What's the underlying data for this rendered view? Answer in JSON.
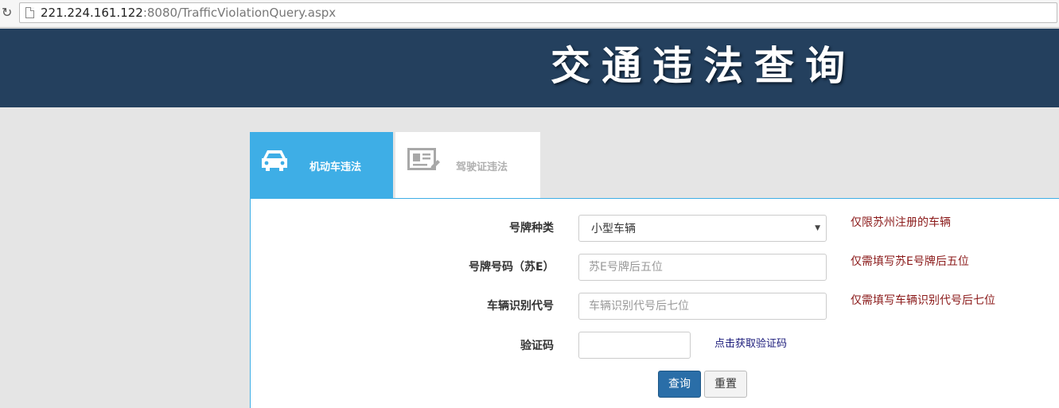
{
  "browser": {
    "url_host": "221.224.161.122",
    "url_rest": ":8080/TrafficViolationQuery.aspx"
  },
  "header": {
    "title": "交通违法查询"
  },
  "tabs": [
    {
      "label": "机动车违法",
      "icon": "car-icon",
      "active": true
    },
    {
      "label": "驾驶证违法",
      "icon": "id-card-icon",
      "active": false
    }
  ],
  "form": {
    "plate_type": {
      "label": "号牌种类",
      "value": "小型车辆",
      "hint": "仅限苏州注册的车辆"
    },
    "plate_number": {
      "label": "号牌号码（苏E）",
      "placeholder": "苏E号牌后五位",
      "hint": "仅需填写苏E号牌后五位"
    },
    "vin": {
      "label": "车辆识别代号",
      "placeholder": "车辆识别代号后七位",
      "hint": "仅需填写车辆识别代号后七位"
    },
    "captcha": {
      "label": "验证码",
      "link": "点击获取验证码"
    },
    "buttons": {
      "query": "查询",
      "reset": "重置"
    }
  },
  "colors": {
    "banner": "#24405e",
    "tab_active": "#3eaee6",
    "hint": "#8b1a1a",
    "primary_button": "#2a6ea8"
  }
}
